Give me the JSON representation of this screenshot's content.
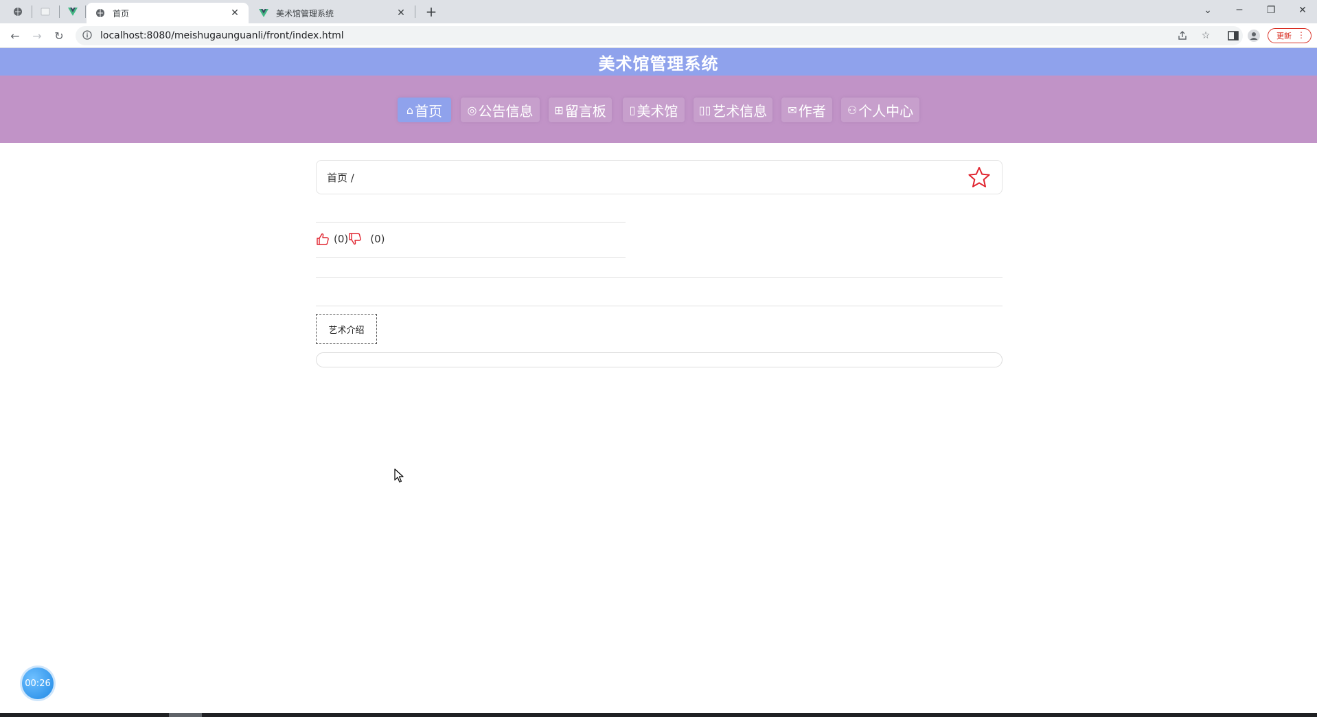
{
  "browser": {
    "tabs": [
      {
        "title": "首页",
        "active": true
      },
      {
        "title": "美术馆管理系统",
        "active": false
      }
    ],
    "new_tab": "+",
    "url": "localhost:8080/meishugaunguanli/front/index.html",
    "update_label": "更新"
  },
  "site": {
    "title": "美术馆管理系统",
    "nav": [
      {
        "label": "首页",
        "icon": "home-icon",
        "active": true
      },
      {
        "label": "公告信息",
        "icon": "bell-icon",
        "active": false
      },
      {
        "label": "留言板",
        "icon": "grid-icon",
        "active": false
      },
      {
        "label": "美术馆",
        "icon": "doc-icon",
        "active": false
      },
      {
        "label": "艺术信息",
        "icon": "columns-icon",
        "active": false
      },
      {
        "label": "作者",
        "icon": "mail-icon",
        "active": false
      },
      {
        "label": "个人中心",
        "icon": "user-icon",
        "active": false
      }
    ],
    "colors": {
      "header": "#8fa2ec",
      "nav": "#c193c7",
      "active": "#8fa2ec",
      "star": "#e0232e"
    }
  },
  "breadcrumb": {
    "text": "首页 /"
  },
  "votes": {
    "up": "0",
    "down": "0"
  },
  "detail": {
    "intro_tab": "艺术介绍",
    "intro_content": ""
  },
  "timer": "00:26"
}
